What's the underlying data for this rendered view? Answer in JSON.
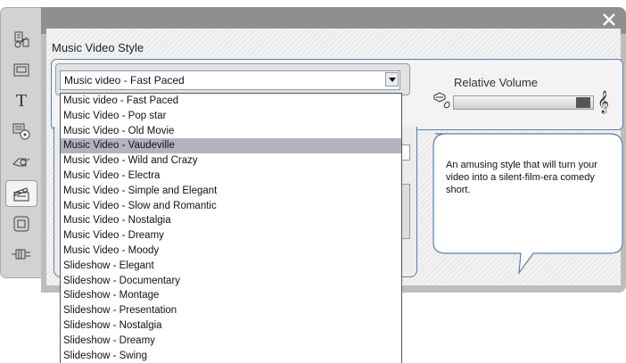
{
  "section_title": "Music Video Style",
  "combo": {
    "selected": "Music video - Fast Paced"
  },
  "dropdown": {
    "items": [
      "Music video - Fast Paced",
      "Music Video - Pop star",
      "Music Video - Old Movie",
      "Music Video - Vaudeville",
      "Music Video - Wild and Crazy",
      "Music Video - Electra",
      "Music Video - Simple and Elegant",
      "Music Video - Slow and Romantic",
      "Music Video - Nostalgia",
      "Music Video - Dreamy",
      "Music Video - Moody",
      "Slideshow - Elegant",
      "Slideshow - Documentary",
      "Slideshow - Montage",
      "Slideshow - Presentation",
      "Slideshow - Nostalgia",
      "Slideshow - Dreamy",
      "Slideshow - Swing"
    ],
    "highlighted_index": 3
  },
  "relative_volume": {
    "label": "Relative Volume",
    "level": 1.0
  },
  "description": "An amusing style that will turn your video into a silent-film-era comedy short.",
  "sidebar": {
    "icons": [
      "scene-editor-icon",
      "title-overlay-icon",
      "text-icon",
      "disc-menu-icon",
      "audio-icon",
      "smartmovie-icon",
      "video-filter-icon",
      "plugin-icon"
    ],
    "active_index": 5
  },
  "colors": {
    "accent_border": "#5a7fa8",
    "highlight": "#b3b3c0",
    "header": "#8f8f8f"
  }
}
